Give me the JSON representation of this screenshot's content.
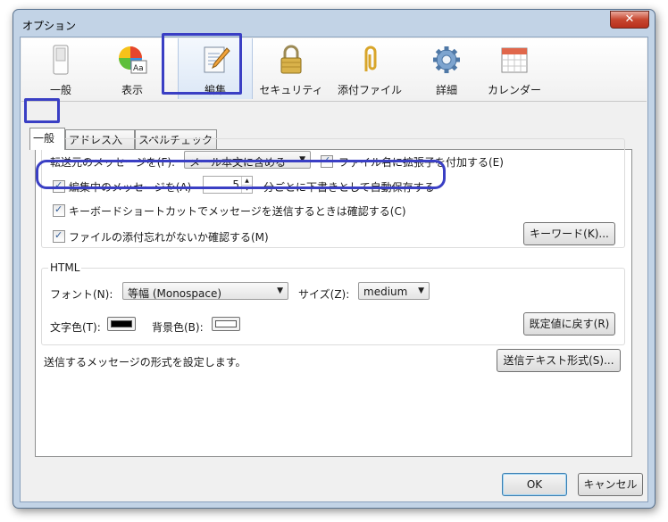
{
  "window": {
    "title": "オプション",
    "close_glyph": "✕"
  },
  "toolbar": {
    "items": [
      {
        "label": "一般",
        "icon": "switch-icon"
      },
      {
        "label": "表示",
        "icon": "display-icon"
      },
      {
        "label": "編集",
        "icon": "compose-icon",
        "selected": true
      },
      {
        "label": "セキュリティ",
        "icon": "lock-icon"
      },
      {
        "label": "添付ファイル",
        "icon": "paperclip-icon"
      },
      {
        "label": "詳細",
        "icon": "gear-icon"
      },
      {
        "label": "カレンダー",
        "icon": "calendar-icon"
      }
    ]
  },
  "tabs": [
    {
      "label": "一般",
      "selected": true
    },
    {
      "label": "アドレス入力"
    },
    {
      "label": "スペルチェック"
    }
  ],
  "general": {
    "forward_label": "転送元のメッセージを(F):",
    "forward_value": "メール本文に含める",
    "extension_label": "ファイル名に拡張子を付加する(E)",
    "extension_checked": true,
    "autosave_label": "編集中のメッセージを(A)",
    "autosave_checked": true,
    "autosave_minutes": "5",
    "autosave_suffix": "分ごとに下書きとして自動保存する",
    "shortcut_label": "キーボードショートカットでメッセージを送信するときは確認する(C)",
    "shortcut_checked": true,
    "attach_label": "ファイルの添付忘れがないか確認する(M)",
    "attach_checked": true,
    "keywords_button": "キーワード(K)..."
  },
  "html": {
    "group_label": "HTML",
    "font_label": "フォント(N):",
    "font_value": "等幅 (Monospace)",
    "size_label": "サイズ(Z):",
    "size_value": "medium",
    "text_color_label": "文字色(T):",
    "bg_color_label": "背景色(B):",
    "reset_button": "既定値に戻す(R)"
  },
  "colors": {
    "text_color": "#000000",
    "bg_color": "#ffffff",
    "highlight": "#3a3fc4"
  },
  "send": {
    "description": "送信するメッセージの形式を設定します。",
    "button": "送信テキスト形式(S)..."
  },
  "footer": {
    "ok": "OK",
    "cancel": "キャンセル"
  }
}
